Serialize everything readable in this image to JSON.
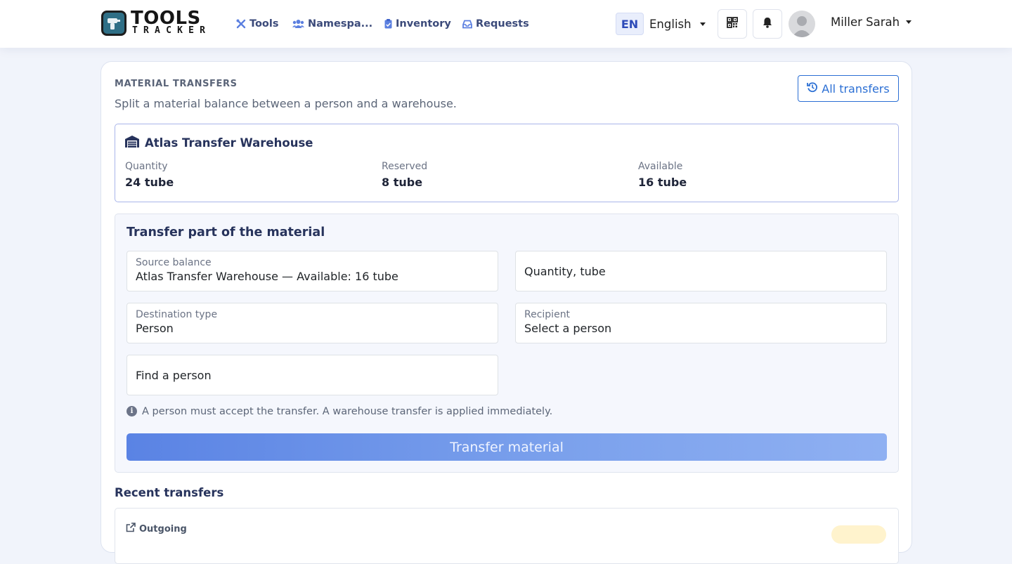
{
  "app": {
    "logo_word_1": "TOOLS",
    "logo_word_2": "TRACKER",
    "accent_color": "#2b6fd4"
  },
  "nav": {
    "links": [
      {
        "label": "Tools",
        "icon": "tools-icon"
      },
      {
        "label": "Namespa...",
        "icon": "users-icon"
      },
      {
        "label": "Inventory",
        "icon": "clipboard-check-icon"
      },
      {
        "label": "Requests",
        "icon": "inbox-icon"
      }
    ],
    "language_code": "EN",
    "language_name": "English",
    "user_name": "Miller Sarah"
  },
  "page": {
    "section_title": "MATERIAL TRANSFERS",
    "subtitle": "Split a material balance between a person and a warehouse.",
    "all_transfers_label": "All transfers"
  },
  "warehouse": {
    "name": "Atlas Transfer Warehouse",
    "stats": [
      {
        "label": "Quantity",
        "value": "24 tube"
      },
      {
        "label": "Reserved",
        "value": "8 tube"
      },
      {
        "label": "Available",
        "value": "16 tube"
      }
    ]
  },
  "form": {
    "title": "Transfer part of the material",
    "source_label": "Source balance",
    "source_value": "Atlas Transfer Warehouse — Available: 16 tube",
    "quantity_placeholder": "Quantity, tube",
    "destination_label": "Destination type",
    "destination_value": "Person",
    "recipient_label": "Recipient",
    "recipient_value": "Select a person",
    "find_person_placeholder": "Find a person",
    "hint": "A person must accept the transfer. A warehouse transfer is applied immediately.",
    "submit_label": "Transfer material"
  },
  "recent": {
    "title": "Recent transfers",
    "items": [
      {
        "direction": "Outgoing"
      }
    ]
  }
}
